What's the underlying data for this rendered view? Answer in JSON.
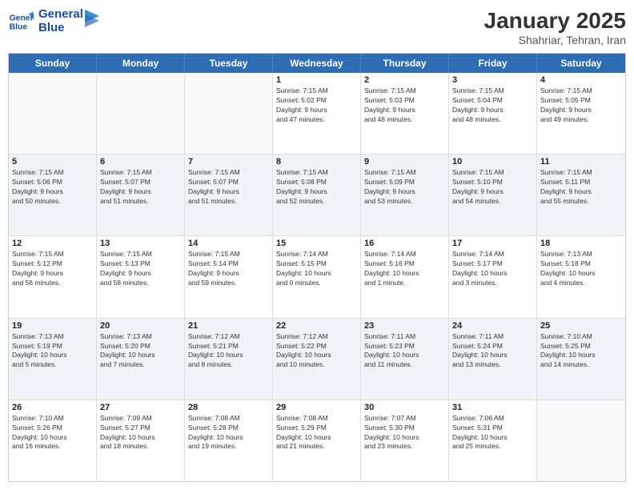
{
  "logo": {
    "line1": "General",
    "line2": "Blue"
  },
  "title": "January 2025",
  "subtitle": "Shahriar, Tehran, Iran",
  "weekdays": [
    "Sunday",
    "Monday",
    "Tuesday",
    "Wednesday",
    "Thursday",
    "Friday",
    "Saturday"
  ],
  "weeks": [
    [
      {
        "day": "",
        "info": ""
      },
      {
        "day": "",
        "info": ""
      },
      {
        "day": "",
        "info": ""
      },
      {
        "day": "1",
        "info": "Sunrise: 7:15 AM\nSunset: 5:02 PM\nDaylight: 9 hours\nand 47 minutes."
      },
      {
        "day": "2",
        "info": "Sunrise: 7:15 AM\nSunset: 5:03 PM\nDaylight: 9 hours\nand 48 minutes."
      },
      {
        "day": "3",
        "info": "Sunrise: 7:15 AM\nSunset: 5:04 PM\nDaylight: 9 hours\nand 48 minutes."
      },
      {
        "day": "4",
        "info": "Sunrise: 7:15 AM\nSunset: 5:05 PM\nDaylight: 9 hours\nand 49 minutes."
      }
    ],
    [
      {
        "day": "5",
        "info": "Sunrise: 7:15 AM\nSunset: 5:06 PM\nDaylight: 9 hours\nand 50 minutes."
      },
      {
        "day": "6",
        "info": "Sunrise: 7:15 AM\nSunset: 5:07 PM\nDaylight: 9 hours\nand 51 minutes."
      },
      {
        "day": "7",
        "info": "Sunrise: 7:15 AM\nSunset: 5:07 PM\nDaylight: 9 hours\nand 51 minutes."
      },
      {
        "day": "8",
        "info": "Sunrise: 7:15 AM\nSunset: 5:08 PM\nDaylight: 9 hours\nand 52 minutes."
      },
      {
        "day": "9",
        "info": "Sunrise: 7:15 AM\nSunset: 5:09 PM\nDaylight: 9 hours\nand 53 minutes."
      },
      {
        "day": "10",
        "info": "Sunrise: 7:15 AM\nSunset: 5:10 PM\nDaylight: 9 hours\nand 54 minutes."
      },
      {
        "day": "11",
        "info": "Sunrise: 7:15 AM\nSunset: 5:11 PM\nDaylight: 9 hours\nand 55 minutes."
      }
    ],
    [
      {
        "day": "12",
        "info": "Sunrise: 7:15 AM\nSunset: 5:12 PM\nDaylight: 9 hours\nand 56 minutes."
      },
      {
        "day": "13",
        "info": "Sunrise: 7:15 AM\nSunset: 5:13 PM\nDaylight: 9 hours\nand 58 minutes."
      },
      {
        "day": "14",
        "info": "Sunrise: 7:15 AM\nSunset: 5:14 PM\nDaylight: 9 hours\nand 59 minutes."
      },
      {
        "day": "15",
        "info": "Sunrise: 7:14 AM\nSunset: 5:15 PM\nDaylight: 10 hours\nand 0 minutes."
      },
      {
        "day": "16",
        "info": "Sunrise: 7:14 AM\nSunset: 5:16 PM\nDaylight: 10 hours\nand 1 minute."
      },
      {
        "day": "17",
        "info": "Sunrise: 7:14 AM\nSunset: 5:17 PM\nDaylight: 10 hours\nand 3 minutes."
      },
      {
        "day": "18",
        "info": "Sunrise: 7:13 AM\nSunset: 5:18 PM\nDaylight: 10 hours\nand 4 minutes."
      }
    ],
    [
      {
        "day": "19",
        "info": "Sunrise: 7:13 AM\nSunset: 5:19 PM\nDaylight: 10 hours\nand 5 minutes."
      },
      {
        "day": "20",
        "info": "Sunrise: 7:13 AM\nSunset: 5:20 PM\nDaylight: 10 hours\nand 7 minutes."
      },
      {
        "day": "21",
        "info": "Sunrise: 7:12 AM\nSunset: 5:21 PM\nDaylight: 10 hours\nand 8 minutes."
      },
      {
        "day": "22",
        "info": "Sunrise: 7:12 AM\nSunset: 5:22 PM\nDaylight: 10 hours\nand 10 minutes."
      },
      {
        "day": "23",
        "info": "Sunrise: 7:11 AM\nSunset: 5:23 PM\nDaylight: 10 hours\nand 11 minutes."
      },
      {
        "day": "24",
        "info": "Sunrise: 7:11 AM\nSunset: 5:24 PM\nDaylight: 10 hours\nand 13 minutes."
      },
      {
        "day": "25",
        "info": "Sunrise: 7:10 AM\nSunset: 5:25 PM\nDaylight: 10 hours\nand 14 minutes."
      }
    ],
    [
      {
        "day": "26",
        "info": "Sunrise: 7:10 AM\nSunset: 5:26 PM\nDaylight: 10 hours\nand 16 minutes."
      },
      {
        "day": "27",
        "info": "Sunrise: 7:09 AM\nSunset: 5:27 PM\nDaylight: 10 hours\nand 18 minutes."
      },
      {
        "day": "28",
        "info": "Sunrise: 7:08 AM\nSunset: 5:28 PM\nDaylight: 10 hours\nand 19 minutes."
      },
      {
        "day": "29",
        "info": "Sunrise: 7:08 AM\nSunset: 5:29 PM\nDaylight: 10 hours\nand 21 minutes."
      },
      {
        "day": "30",
        "info": "Sunrise: 7:07 AM\nSunset: 5:30 PM\nDaylight: 10 hours\nand 23 minutes."
      },
      {
        "day": "31",
        "info": "Sunrise: 7:06 AM\nSunset: 5:31 PM\nDaylight: 10 hours\nand 25 minutes."
      },
      {
        "day": "",
        "info": ""
      }
    ]
  ]
}
